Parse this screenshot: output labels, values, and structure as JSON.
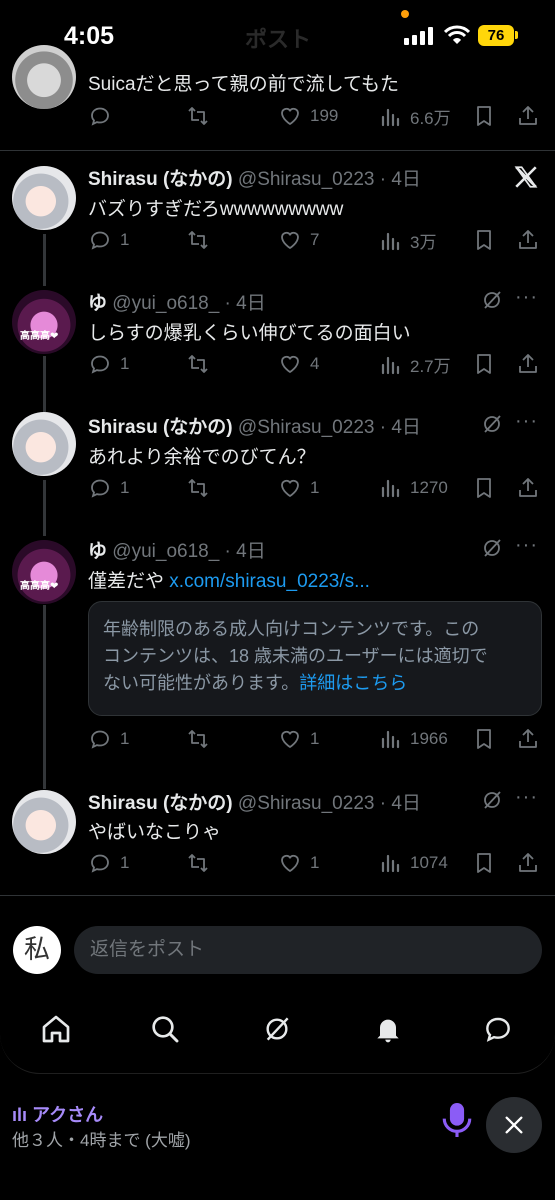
{
  "status_bar": {
    "time": "4:05",
    "title": "ポスト",
    "battery": "76"
  },
  "tweets": [
    {
      "text": "Suicaだと思って親の前で流してもた",
      "replies": "",
      "likes": "199",
      "views": "6.6万"
    },
    {
      "name": "Shirasu (なかの)",
      "handle": "@Shirasu_0223 · 4日",
      "text": "バズりすぎだろwwwwwwwww",
      "replies": "1",
      "likes": "7",
      "views": "3万"
    },
    {
      "name": "ゆ",
      "handle": "@yui_o618_ · 4日",
      "text": "しらすの爆乳くらい伸びてるの面白い",
      "replies": "1",
      "likes": "4",
      "views": "2.7万"
    },
    {
      "name": "Shirasu (なかの)",
      "handle": "@Shirasu_0223 · 4日",
      "text": "あれより余裕でのびてん？",
      "replies": "1",
      "likes": "1",
      "views": "1270"
    },
    {
      "name": "ゆ",
      "handle": "@yui_o618_ · 4日",
      "text": "僅差だや",
      "link": "x.com/shirasu_0223/s...",
      "replies": "1",
      "likes": "1",
      "views": "1966",
      "warning": {
        "line1": "年齢制限のある成人向けコンテンツです。この",
        "line2": "コンテンツは、18 歳未満のユーザーには適切で",
        "line3": "ない可能性があります。",
        "link": "詳細はこちら"
      }
    },
    {
      "name": "Shirasu (なかの)",
      "handle": "@Shirasu_0223 · 4日",
      "text": "やばいなこりゃ",
      "replies": "1",
      "likes": "1",
      "views": "1074"
    }
  ],
  "avatar_badge": "高高高❤",
  "reply": {
    "placeholder": "返信をポスト",
    "avatar_char": "私"
  },
  "tabbar": [
    "home-icon",
    "search-icon",
    "grok-icon",
    "bell-icon",
    "messages-icon"
  ],
  "live": {
    "title": "アクさん",
    "subtitle": "他３人・4時まで (大嘘)"
  },
  "colors": {
    "background": "#000000",
    "link": "#1d9bf0",
    "muted": "#71767b",
    "live_accent": "#a78bfa",
    "battery": "#ffd60a"
  }
}
